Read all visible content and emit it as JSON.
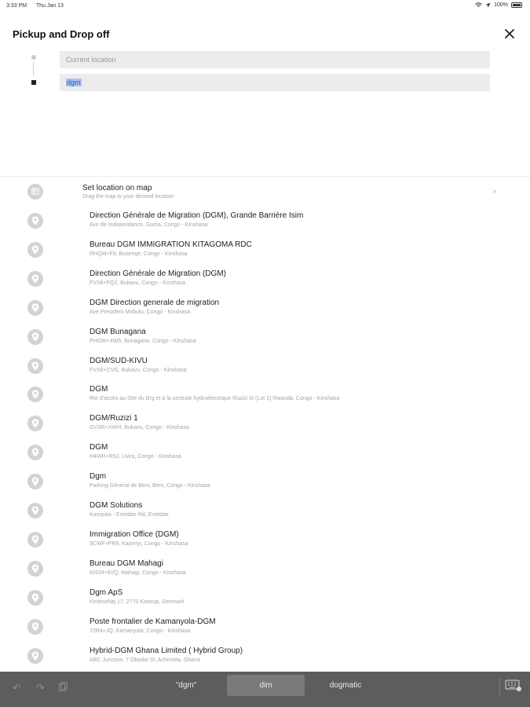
{
  "status_bar": {
    "time": "3:33 PM",
    "date": "Thu Jan 13",
    "battery": "100%"
  },
  "header": {
    "title": "Pickup and Drop off"
  },
  "pickup": {
    "placeholder": "Current location"
  },
  "dropoff": {
    "value": "dgm"
  },
  "map_option": {
    "title": "Set location on map",
    "subtitle": "Drag the map to your desired location"
  },
  "results": [
    {
      "title": "Direction Générale de Migration (DGM), Grande Barrière Isim",
      "subtitle": "Ave de Independance, Goma, Congo - Kinshasa"
    },
    {
      "title": "Bureau DGM IMMIGRATION KITAGOMA RDC",
      "subtitle": "RHQM+F9, Busenge, Congo - Kinshasa"
    },
    {
      "title": "Direction Générale de Migration (DGM)",
      "subtitle": "FVX8+FQ2, Bukavu, Congo - Kinshasa"
    },
    {
      "title": "DGM Direction generale de migration",
      "subtitle": "Ave President Mobutu, Congo - Kinshasa"
    },
    {
      "title": "DGM Bunagana",
      "subtitle": "PHGW+4W5, Bunagana, Congo - Kinshasa"
    },
    {
      "title": "DGM/SUD-KIVU",
      "subtitle": "FVX8+CVG, Bukavu, Congo - Kinshasa"
    },
    {
      "title": "DGM",
      "subtitle": "Rte d'accès au Site du Brg et à la centrale hydroélectrique Ruzizi III (Lot 1) Rwanda, Congo - Kinshasa"
    },
    {
      "title": "DGM/Ruzizi 1",
      "subtitle": "GVSR+XWH, Bukavu, Congo - Kinshasa"
    },
    {
      "title": "DGM",
      "subtitle": "H4WR+R9J, Uvira, Congo - Kinshasa"
    },
    {
      "title": "Dgm",
      "subtitle": "Parking Général de Beni, Beni, Congo - Kinshasa"
    },
    {
      "title": "DGM Solutions",
      "subtitle": "Kampala - Entebbe Rd, Entebbe"
    },
    {
      "title": "Immigration Office (DGM)",
      "subtitle": "9CWF+FR9, Kasenyi, Congo - Kinshasa"
    },
    {
      "title": "Bureau DGM Mahagi",
      "subtitle": "92GH+9VQ, Mahagi, Congo - Kinshasa"
    },
    {
      "title": "Dgm ApS",
      "subtitle": "Kirstinehøj 17, 2770 Kastrup, Denmark"
    },
    {
      "title": "Poste frontalier de Kamanyola-DGM",
      "subtitle": "72R4+JQ, Kamanyola, Congo - Kinshasa"
    },
    {
      "title": "Hybrid-DGM Ghana Limited ( Hybrid Group)",
      "subtitle": "ABC Junction, 7 Obodai St, Achimota, Ghana"
    }
  ],
  "keyboard": {
    "suggestions": [
      "\"dgm\"",
      "dim",
      "dogmatic"
    ]
  }
}
